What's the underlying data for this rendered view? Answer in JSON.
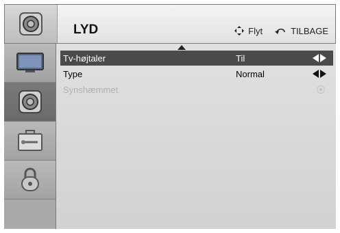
{
  "header": {
    "title": "LYD",
    "move_hint": "Flyt",
    "back_hint": "TILBAGE",
    "icon": "speaker-icon"
  },
  "sidebar": {
    "items": [
      {
        "icon": "tv-icon",
        "active": false
      },
      {
        "icon": "speaker-icon",
        "active": true
      },
      {
        "icon": "toolbox-icon",
        "active": false
      },
      {
        "icon": "lock-icon",
        "active": false
      }
    ]
  },
  "menu": {
    "items": [
      {
        "label": "Tv-højtaler",
        "value": "Til",
        "selected": true
      },
      {
        "label": "Type",
        "value": "Normal",
        "selected": false
      },
      {
        "label": "Synshæmmet",
        "value": "",
        "selected": false,
        "disabled": true
      }
    ]
  },
  "colors": {
    "selected_row": "#4a4a4a",
    "sidebar_active": "#6a6a6a",
    "disabled_text": "#b0b0b0"
  }
}
